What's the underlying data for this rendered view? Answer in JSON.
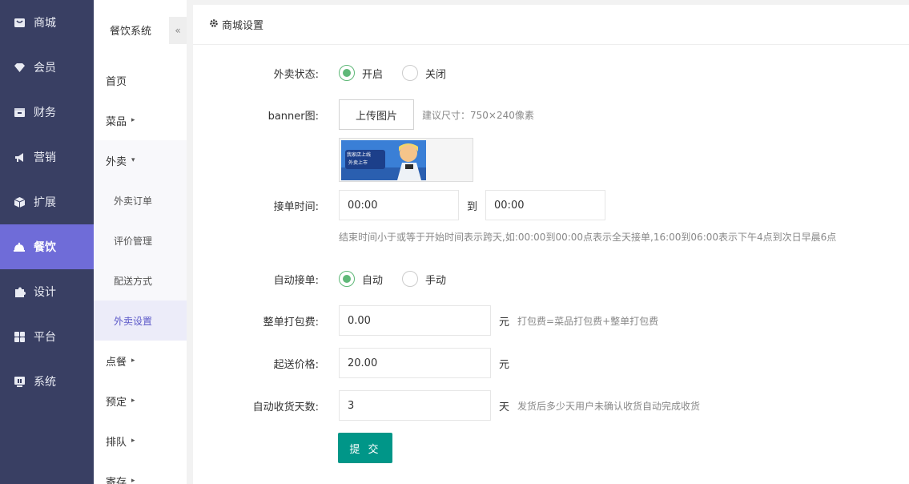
{
  "nav1": {
    "items": [
      {
        "label": "商城",
        "icon": "store-icon"
      },
      {
        "label": "会员",
        "icon": "diamond-icon"
      },
      {
        "label": "财务",
        "icon": "finance-icon"
      },
      {
        "label": "营销",
        "icon": "megaphone-icon"
      },
      {
        "label": "扩展",
        "icon": "box-icon"
      },
      {
        "label": "餐饮",
        "icon": "dish-icon",
        "active": true
      },
      {
        "label": "设计",
        "icon": "puzzle-icon"
      },
      {
        "label": "平台",
        "icon": "grid-icon"
      },
      {
        "label": "系统",
        "icon": "monitor-icon"
      }
    ],
    "active_color": "#6f6cd8",
    "bg_color": "#393f63"
  },
  "nav2": {
    "title": "餐饮系统",
    "collapse_glyph": "«",
    "items": [
      {
        "label": "首页"
      },
      {
        "label": "菜品",
        "caret": "▸"
      },
      {
        "label": "外卖",
        "caret": "▾"
      },
      {
        "label": "外卖订单",
        "sub": true
      },
      {
        "label": "评价管理",
        "sub": true
      },
      {
        "label": "配送方式",
        "sub": true
      },
      {
        "label": "外卖设置",
        "sub": true,
        "active": true
      },
      {
        "label": "点餐",
        "caret": "▸"
      },
      {
        "label": "预定",
        "caret": "▸"
      },
      {
        "label": "排队",
        "caret": "▸"
      },
      {
        "label": "寄存",
        "caret": "▸"
      }
    ]
  },
  "panel": {
    "title": "商城设置",
    "icon": "gear-icon"
  },
  "form": {
    "takeout_status": {
      "label": "外卖状态:",
      "options": [
        "开启",
        "关闭"
      ],
      "selected": "开启"
    },
    "banner": {
      "label": "banner图:",
      "upload_label": "上传图片",
      "hint": "建议尺寸：750×240像素",
      "thumb_text_1": "我家店上线",
      "thumb_text_2": "外卖上市"
    },
    "order_time": {
      "label": "接单时间:",
      "start": "00:00",
      "separator": "到",
      "end": "00:00",
      "hint": "结束时间小于或等于开始时间表示跨天,如:00:00到00:00点表示全天接单,16:00到06:00表示下午4点到次日早晨6点"
    },
    "auto_accept": {
      "label": "自动接单:",
      "options": [
        "自动",
        "手动"
      ],
      "selected": "自动"
    },
    "packing_fee": {
      "label": "整单打包费:",
      "value": "0.00",
      "unit": "元",
      "hint": "打包费=菜品打包费+整单打包费"
    },
    "min_price": {
      "label": "起送价格:",
      "value": "20.00",
      "unit": "元"
    },
    "auto_receive_days": {
      "label": "自动收货天数:",
      "value": "3",
      "unit": "天",
      "hint": "发货后多少天用户未确认收货自动完成收货"
    },
    "submit_label": "提 交",
    "submit_color": "#009688",
    "radio_color": "#5fb878"
  }
}
